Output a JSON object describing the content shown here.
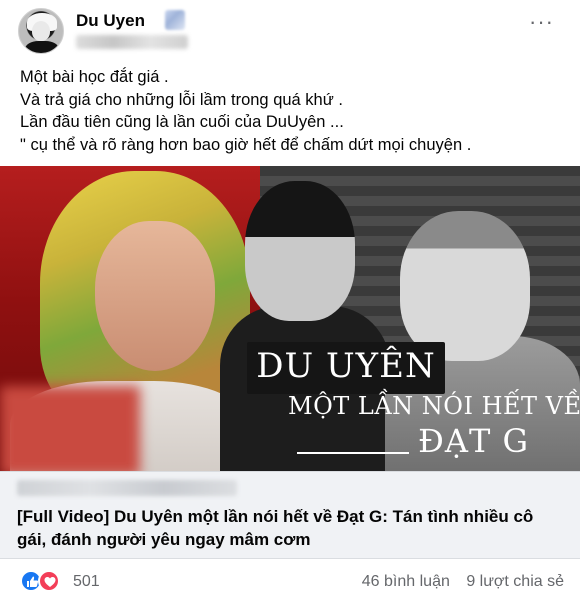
{
  "post": {
    "author_name": "Du Uyen",
    "more_label": "···",
    "lines": [
      "Một bài học đắt giá .",
      "Và trả giá cho những lỗi lầm trong quá khứ .",
      "Lần đầu tiên cũng là lần cuối của DuUyên ...",
      "\" cụ thể và rõ ràng hơn bao giờ hết để chấm dứt mọi chuyện ."
    ]
  },
  "media": {
    "overlay_title": "DU UYÊN",
    "overlay_subtitle": "MỘT LẦN NÓI HẾT VỀ",
    "overlay_name": "ĐẠT G"
  },
  "link_preview": {
    "title": "[Full Video] Du Uyên một lần nói hết về Đạt G: Tán tình nhiều cô gái, đánh người yêu ngay mâm cơm"
  },
  "footer": {
    "reaction_count": "501",
    "comments": "46 bình luận",
    "shares": "9 lượt chia sẻ"
  },
  "icons": [
    "like-icon",
    "love-icon",
    "more-options-icon"
  ],
  "colors": {
    "like": "#1877f2",
    "love": "#f33e58",
    "meta_text": "#65676b"
  }
}
